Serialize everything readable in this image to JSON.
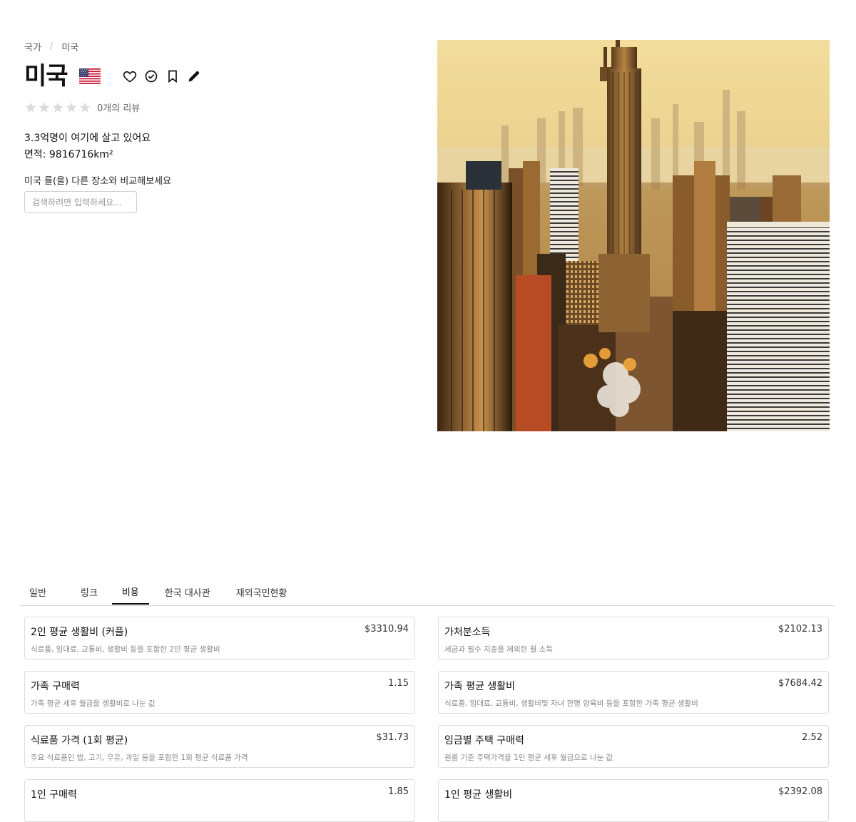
{
  "breadcrumb": {
    "parent": "국가",
    "separator": "/",
    "current": "미국"
  },
  "country": {
    "name": "미국",
    "flag_icon": "us-flag-icon"
  },
  "actions": [
    {
      "name": "favorite-button",
      "icon": "heart-icon"
    },
    {
      "name": "visited-button",
      "icon": "check-circle-icon"
    },
    {
      "name": "bookmark-button",
      "icon": "bookmark-icon"
    },
    {
      "name": "edit-button",
      "icon": "pencil-icon"
    }
  ],
  "rating": {
    "stars_filled": 0,
    "stars_total": 5,
    "review_count": "0개의 리뷰"
  },
  "stats": {
    "population": "3.3억명이 여기에 살고 있어요",
    "area": "면적: 9816716km²"
  },
  "compare": {
    "label": "미국 를(을) 다른 장소와 비교해보세요",
    "placeholder": "검색하려면 입력하세요..."
  },
  "tabs": [
    {
      "label": "일반",
      "active": false
    },
    {
      "label": "링크",
      "active": false
    },
    {
      "label": "비용",
      "active": true
    },
    {
      "label": "한국 대사관",
      "active": false
    },
    {
      "label": "재외국민현황",
      "active": false
    }
  ],
  "cards": [
    {
      "title": "2인 평균 생활비 (커플)",
      "value": "$3310.94",
      "desc": "식료품, 임대료, 교통비, 생활비 등을 포함한 2인 평균 생활비"
    },
    {
      "title": "가처분소득",
      "value": "$2102.13",
      "desc": "세금과 필수 지출을 제외한 월 소득"
    },
    {
      "title": "가족 구매력",
      "value": "1.15",
      "desc": "가족 평균 세후 월급을 생활비로 나눈 값"
    },
    {
      "title": "가족 평균 생활비",
      "value": "$7684.42",
      "desc": "식료품, 임대료, 교통비, 생활비및 자녀 한명 양육비 등을 포함한 가족 평균 생활비"
    },
    {
      "title": "식료품 가격 (1회 평균)",
      "value": "$31.73",
      "desc": "주요 식료품인 밥, 고기, 우유, 과일 등을 포함한 1회 평균 식료품 가격"
    },
    {
      "title": "임금별 주택 구매력",
      "value": "2.52",
      "desc": "원룸 기준 주택가격을 1인 평균 세후 월급으로 나눈 값"
    },
    {
      "title": "1인 구매력",
      "value": "1.85",
      "desc": ""
    },
    {
      "title": "1인 평균 생활비",
      "value": "$2392.08",
      "desc": ""
    }
  ]
}
